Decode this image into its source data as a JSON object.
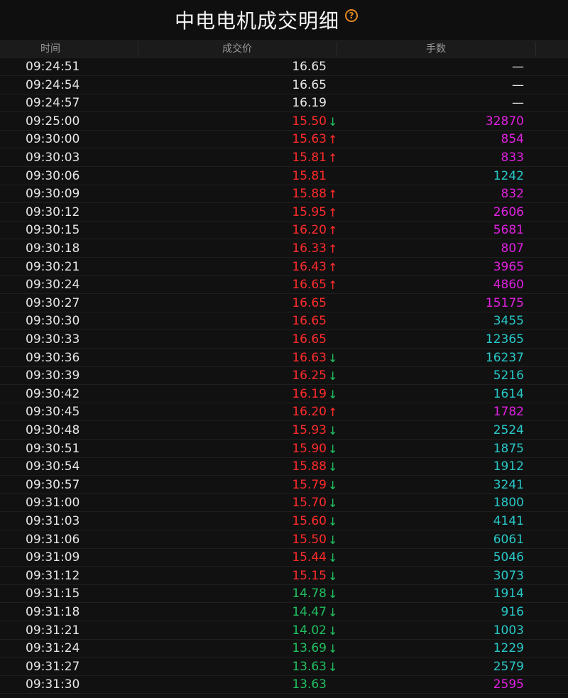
{
  "title": "中电电机成交明细",
  "help_icon_glyph": "?",
  "headers": {
    "time": "时间",
    "price": "成交价",
    "volume": "手数"
  },
  "colors": {
    "white": "#e6e6e6",
    "red": "#ff2b2b",
    "green": "#20c060",
    "magenta": "#e020e0",
    "cyan": "#28c8c8",
    "help": "#e58a1f"
  },
  "rows": [
    {
      "time": "09:24:51",
      "price": "16.65",
      "pc": "white",
      "arrow": "",
      "ac": "",
      "vol": "—",
      "vc": "white"
    },
    {
      "time": "09:24:54",
      "price": "16.65",
      "pc": "white",
      "arrow": "",
      "ac": "",
      "vol": "—",
      "vc": "white"
    },
    {
      "time": "09:24:57",
      "price": "16.19",
      "pc": "white",
      "arrow": "",
      "ac": "",
      "vol": "—",
      "vc": "white"
    },
    {
      "time": "09:25:00",
      "price": "15.50",
      "pc": "red",
      "arrow": "↓",
      "ac": "green",
      "vol": "32870",
      "vc": "magenta"
    },
    {
      "time": "09:30:00",
      "price": "15.63",
      "pc": "red",
      "arrow": "↑",
      "ac": "red",
      "vol": "854",
      "vc": "magenta"
    },
    {
      "time": "09:30:03",
      "price": "15.81",
      "pc": "red",
      "arrow": "↑",
      "ac": "red",
      "vol": "833",
      "vc": "magenta"
    },
    {
      "time": "09:30:06",
      "price": "15.81",
      "pc": "red",
      "arrow": "",
      "ac": "",
      "vol": "1242",
      "vc": "cyan"
    },
    {
      "time": "09:30:09",
      "price": "15.88",
      "pc": "red",
      "arrow": "↑",
      "ac": "red",
      "vol": "832",
      "vc": "magenta"
    },
    {
      "time": "09:30:12",
      "price": "15.95",
      "pc": "red",
      "arrow": "↑",
      "ac": "red",
      "vol": "2606",
      "vc": "magenta"
    },
    {
      "time": "09:30:15",
      "price": "16.20",
      "pc": "red",
      "arrow": "↑",
      "ac": "red",
      "vol": "5681",
      "vc": "magenta"
    },
    {
      "time": "09:30:18",
      "price": "16.33",
      "pc": "red",
      "arrow": "↑",
      "ac": "red",
      "vol": "807",
      "vc": "magenta"
    },
    {
      "time": "09:30:21",
      "price": "16.43",
      "pc": "red",
      "arrow": "↑",
      "ac": "red",
      "vol": "3965",
      "vc": "magenta"
    },
    {
      "time": "09:30:24",
      "price": "16.65",
      "pc": "red",
      "arrow": "↑",
      "ac": "red",
      "vol": "4860",
      "vc": "magenta"
    },
    {
      "time": "09:30:27",
      "price": "16.65",
      "pc": "red",
      "arrow": "",
      "ac": "",
      "vol": "15175",
      "vc": "magenta"
    },
    {
      "time": "09:30:30",
      "price": "16.65",
      "pc": "red",
      "arrow": "",
      "ac": "",
      "vol": "3455",
      "vc": "cyan"
    },
    {
      "time": "09:30:33",
      "price": "16.65",
      "pc": "red",
      "arrow": "",
      "ac": "",
      "vol": "12365",
      "vc": "cyan"
    },
    {
      "time": "09:30:36",
      "price": "16.63",
      "pc": "red",
      "arrow": "↓",
      "ac": "green",
      "vol": "16237",
      "vc": "cyan"
    },
    {
      "time": "09:30:39",
      "price": "16.25",
      "pc": "red",
      "arrow": "↓",
      "ac": "green",
      "vol": "5216",
      "vc": "cyan"
    },
    {
      "time": "09:30:42",
      "price": "16.19",
      "pc": "red",
      "arrow": "↓",
      "ac": "green",
      "vol": "1614",
      "vc": "cyan"
    },
    {
      "time": "09:30:45",
      "price": "16.20",
      "pc": "red",
      "arrow": "↑",
      "ac": "red",
      "vol": "1782",
      "vc": "magenta"
    },
    {
      "time": "09:30:48",
      "price": "15.93",
      "pc": "red",
      "arrow": "↓",
      "ac": "green",
      "vol": "2524",
      "vc": "cyan"
    },
    {
      "time": "09:30:51",
      "price": "15.90",
      "pc": "red",
      "arrow": "↓",
      "ac": "green",
      "vol": "1875",
      "vc": "cyan"
    },
    {
      "time": "09:30:54",
      "price": "15.88",
      "pc": "red",
      "arrow": "↓",
      "ac": "green",
      "vol": "1912",
      "vc": "cyan"
    },
    {
      "time": "09:30:57",
      "price": "15.79",
      "pc": "red",
      "arrow": "↓",
      "ac": "green",
      "vol": "3241",
      "vc": "cyan"
    },
    {
      "time": "09:31:00",
      "price": "15.70",
      "pc": "red",
      "arrow": "↓",
      "ac": "green",
      "vol": "1800",
      "vc": "cyan"
    },
    {
      "time": "09:31:03",
      "price": "15.60",
      "pc": "red",
      "arrow": "↓",
      "ac": "green",
      "vol": "4141",
      "vc": "cyan"
    },
    {
      "time": "09:31:06",
      "price": "15.50",
      "pc": "red",
      "arrow": "↓",
      "ac": "green",
      "vol": "6061",
      "vc": "cyan"
    },
    {
      "time": "09:31:09",
      "price": "15.44",
      "pc": "red",
      "arrow": "↓",
      "ac": "green",
      "vol": "5046",
      "vc": "cyan"
    },
    {
      "time": "09:31:12",
      "price": "15.15",
      "pc": "red",
      "arrow": "↓",
      "ac": "green",
      "vol": "3073",
      "vc": "cyan"
    },
    {
      "time": "09:31:15",
      "price": "14.78",
      "pc": "green",
      "arrow": "↓",
      "ac": "green",
      "vol": "1914",
      "vc": "cyan"
    },
    {
      "time": "09:31:18",
      "price": "14.47",
      "pc": "green",
      "arrow": "↓",
      "ac": "green",
      "vol": "916",
      "vc": "cyan"
    },
    {
      "time": "09:31:21",
      "price": "14.02",
      "pc": "green",
      "arrow": "↓",
      "ac": "green",
      "vol": "1003",
      "vc": "cyan"
    },
    {
      "time": "09:31:24",
      "price": "13.69",
      "pc": "green",
      "arrow": "↓",
      "ac": "green",
      "vol": "1229",
      "vc": "cyan"
    },
    {
      "time": "09:31:27",
      "price": "13.63",
      "pc": "green",
      "arrow": "↓",
      "ac": "green",
      "vol": "2579",
      "vc": "cyan"
    },
    {
      "time": "09:31:30",
      "price": "13.63",
      "pc": "green",
      "arrow": "",
      "ac": "",
      "vol": "2595",
      "vc": "magenta"
    }
  ]
}
